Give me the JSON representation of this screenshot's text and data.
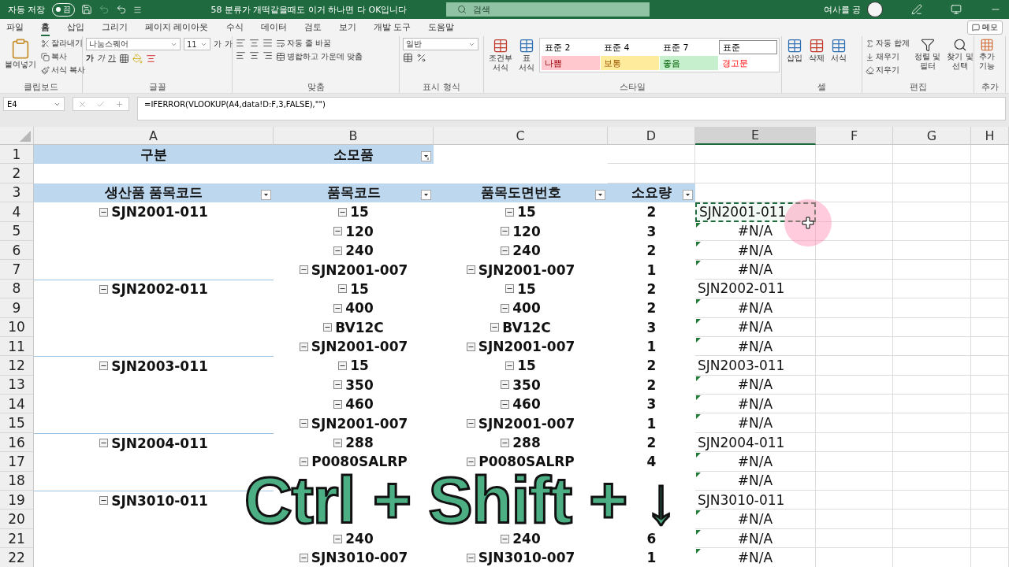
{
  "title_bar": {
    "autosave_label": "자동 저장",
    "autosave_toggle": {
      "label": "끔",
      "on": false
    },
    "document_title": "58 분류가 개떡같을때도 이거 하나면 다 OK입니다",
    "search_placeholder": "검색",
    "user_name": "여사를 공"
  },
  "menu_tabs": [
    {
      "label": "파일",
      "selected": false
    },
    {
      "label": "홈",
      "selected": true
    },
    {
      "label": "삽입",
      "selected": false
    },
    {
      "label": "그리기",
      "selected": false
    },
    {
      "label": "페이지 레이아웃",
      "selected": false
    },
    {
      "label": "수식",
      "selected": false
    },
    {
      "label": "데이터",
      "selected": false
    },
    {
      "label": "검토",
      "selected": false
    },
    {
      "label": "보기",
      "selected": false
    },
    {
      "label": "개발 도구",
      "selected": false
    },
    {
      "label": "도움말",
      "selected": false
    }
  ],
  "memo_button": "메모",
  "ribbon": {
    "clipboard": {
      "paste": "붙여넣기",
      "cut": "잘라내기",
      "copy": "복사",
      "format_painter": "서식 복사",
      "label": "클립보드"
    },
    "font": {
      "name": "나눔스퀘어",
      "size": "11",
      "bold": "가",
      "italic": "가",
      "underline": "가",
      "grow": "가",
      "shrink": "가",
      "label": "글꼴"
    },
    "alignment": {
      "wrap": "자동 줄 바꿈",
      "merge": "병합하고 가운데 맞춤",
      "label": "맞춤"
    },
    "number": {
      "format": "일반",
      "label": "표시 형식"
    },
    "styles": {
      "conditional": [
        "조건부",
        "서식"
      ],
      "table": [
        "표",
        "서식"
      ],
      "items": [
        {
          "label": "표준 2",
          "kind": "plain"
        },
        {
          "label": "표준 4",
          "kind": "plain"
        },
        {
          "label": "표준 7",
          "kind": "plain"
        },
        {
          "label": "표준",
          "kind": "current"
        },
        {
          "label": "나쁨",
          "kind": "bad"
        },
        {
          "label": "보통",
          "kind": "neutral"
        },
        {
          "label": "좋음",
          "kind": "good"
        },
        {
          "label": "경고문",
          "kind": "warning"
        }
      ],
      "label": "스타일"
    },
    "cells": {
      "insert": "삽입",
      "delete": "삭제",
      "format": "서식",
      "label": "셀"
    },
    "editing": {
      "autosum": "자동 합계",
      "fill": "채우기",
      "clear": "지우기",
      "sort": [
        "정렬 및",
        "필터"
      ],
      "find": [
        "찾기 및",
        "선택"
      ],
      "label": "편집"
    },
    "addins": {
      "button": [
        "추가",
        "기능"
      ],
      "label": "추가"
    }
  },
  "formula_bar": {
    "name_box": "E4",
    "formula": "=IFERROR(VLOOKUP(A4,data!D:F,3,FALSE),\"\")"
  },
  "columns": [
    {
      "label": "A",
      "selected": false
    },
    {
      "label": "B",
      "selected": false
    },
    {
      "label": "C",
      "selected": false
    },
    {
      "label": "D",
      "selected": false
    },
    {
      "label": "E",
      "selected": true
    },
    {
      "label": "F",
      "selected": false
    },
    {
      "label": "G",
      "selected": false
    },
    {
      "label": "H",
      "selected": false
    }
  ],
  "rows": [
    {
      "number": "1",
      "kind": "title",
      "a": "구분",
      "b": "소모품"
    },
    {
      "number": "2",
      "kind": "blank"
    },
    {
      "number": "3",
      "kind": "header",
      "a": "생산품 품목코드",
      "b": "품목코드",
      "c": "품목도면번호",
      "d": "소요량"
    },
    {
      "number": "4",
      "kind": "data",
      "a": "SJN2001-011",
      "b": "15",
      "c": "15",
      "d": "2",
      "e": "SJN2001-011",
      "e_selected": true,
      "e_error": false
    },
    {
      "number": "5",
      "kind": "data",
      "b": "120",
      "c": "120",
      "d": "3",
      "e": "#N/A",
      "e_selected": false,
      "e_error": true
    },
    {
      "number": "6",
      "kind": "data",
      "b": "240",
      "c": "240",
      "d": "2",
      "e": "#N/A",
      "e_selected": false,
      "e_error": true
    },
    {
      "number": "7",
      "kind": "data",
      "b": "SJN2001-007",
      "c": "SJN2001-007",
      "d": "1",
      "e": "#N/A",
      "e_selected": false,
      "e_error": true
    },
    {
      "number": "8",
      "kind": "data",
      "a": "SJN2002-011",
      "b": "15",
      "c": "15",
      "d": "2",
      "e": "SJN2002-011",
      "e_selected": false,
      "e_error": false
    },
    {
      "number": "9",
      "kind": "data",
      "b": "400",
      "c": "400",
      "d": "2",
      "e": "#N/A",
      "e_selected": false,
      "e_error": true
    },
    {
      "number": "10",
      "kind": "data",
      "b": "BV12C",
      "c": "BV12C",
      "d": "3",
      "e": "#N/A",
      "e_selected": false,
      "e_error": true
    },
    {
      "number": "11",
      "kind": "data",
      "b": "SJN2001-007",
      "c": "SJN2001-007",
      "d": "1",
      "e": "#N/A",
      "e_selected": false,
      "e_error": true
    },
    {
      "number": "12",
      "kind": "data",
      "a": "SJN2003-011",
      "b": "15",
      "c": "15",
      "d": "2",
      "e": "SJN2003-011",
      "e_selected": false,
      "e_error": false
    },
    {
      "number": "13",
      "kind": "data",
      "b": "350",
      "c": "350",
      "d": "2",
      "e": "#N/A",
      "e_selected": false,
      "e_error": true
    },
    {
      "number": "14",
      "kind": "data",
      "b": "460",
      "c": "460",
      "d": "3",
      "e": "#N/A",
      "e_selected": false,
      "e_error": true
    },
    {
      "number": "15",
      "kind": "data",
      "b": "SJN2001-007",
      "c": "SJN2001-007",
      "d": "1",
      "e": "#N/A",
      "e_selected": false,
      "e_error": true
    },
    {
      "number": "16",
      "kind": "data",
      "a": "SJN2004-011",
      "b": "288",
      "c": "288",
      "d": "2",
      "e": "SJN2004-011",
      "e_selected": false,
      "e_error": false
    },
    {
      "number": "17",
      "kind": "data",
      "b": "P0080SALRP",
      "c": "P0080SALRP",
      "d": "4",
      "e": "#N/A",
      "e_selected": false,
      "e_error": true
    },
    {
      "number": "18",
      "kind": "data",
      "e": "#N/A",
      "e_selected": false,
      "e_error": true
    },
    {
      "number": "19",
      "kind": "data",
      "a": "SJN3010-011",
      "e": "SJN3010-011",
      "e_selected": false,
      "e_error": false
    },
    {
      "number": "20",
      "kind": "data",
      "e": "#N/A",
      "e_selected": false,
      "e_error": true
    },
    {
      "number": "21",
      "kind": "data",
      "b": "240",
      "c": "240",
      "d": "6",
      "e": "#N/A",
      "e_selected": false,
      "e_error": true
    },
    {
      "number": "22",
      "kind": "data",
      "b": "SJN3010-007",
      "c": "SJN3010-007",
      "d": "1",
      "e": "#N/A",
      "e_selected": false,
      "e_error": true
    }
  ],
  "caption": "Ctrl + Shift + ↓"
}
